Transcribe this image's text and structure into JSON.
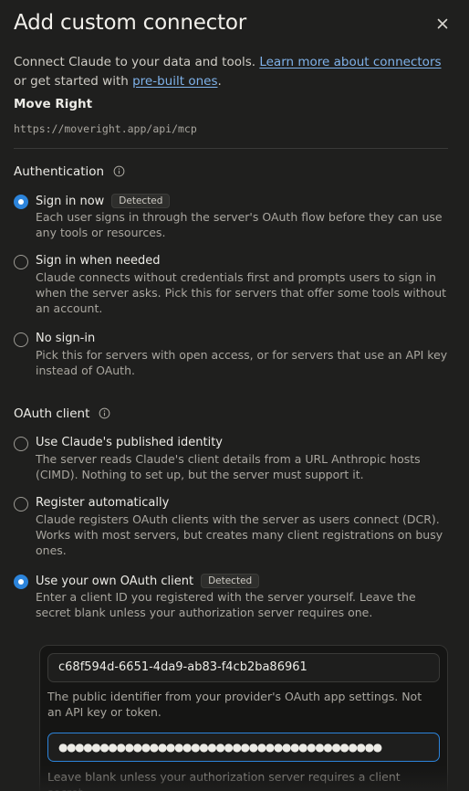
{
  "dialog": {
    "title": "Add custom connector",
    "intro_prefix": "Connect Claude to your data and tools. ",
    "learn_more_link": "Learn more about connectors",
    "intro_middle": " or get started with ",
    "prebuilt_link": "pre-built ones",
    "intro_suffix": "."
  },
  "server": {
    "name": "Move Right",
    "url": "https://moveright.app/api/mcp"
  },
  "authentication": {
    "heading": "Authentication",
    "options": [
      {
        "label": "Sign in now",
        "badge": "Detected",
        "checked": true,
        "description": "Each user signs in through the server's OAuth flow before they can use any tools or resources."
      },
      {
        "label": "Sign in when needed",
        "badge": "",
        "checked": false,
        "description": "Claude connects without credentials first and prompts users to sign in when the server asks. Pick this for servers that offer some tools without an account."
      },
      {
        "label": "No sign-in",
        "badge": "",
        "checked": false,
        "description": "Pick this for servers with open access, or for servers that use an API key instead of OAuth."
      }
    ]
  },
  "oauth_client": {
    "heading": "OAuth client",
    "options": [
      {
        "label": "Use Claude's published identity",
        "badge": "",
        "checked": false,
        "description": "The server reads Claude's client details from a URL Anthropic hosts (CIMD). Nothing to set up, but the server must support it."
      },
      {
        "label": "Register automatically",
        "badge": "",
        "checked": false,
        "description": "Claude registers OAuth clients with the server as users connect (DCR). Works with most servers, but creates many client registrations on busy ones."
      },
      {
        "label": "Use your own OAuth client",
        "badge": "Detected",
        "checked": true,
        "description": "Enter a client ID you registered with the server yourself. Leave the secret blank unless your authorization server requires one."
      }
    ],
    "client_id_value": "c68f594d-6651-4da9-ab83-f4cb2ba86961",
    "client_id_hint": "The public identifier from your provider's OAuth app settings. Not an API key or token.",
    "client_secret_value": "●●●●●●●●●●●●●●●●●●●●●●●●●●●●●●●●●●●●●●●",
    "client_secret_hint": "Leave blank unless your authorization server requires a client secret."
  },
  "colors": {
    "background": "#1f1f1e",
    "accent": "#2c84db",
    "link": "#7fb2ea"
  }
}
